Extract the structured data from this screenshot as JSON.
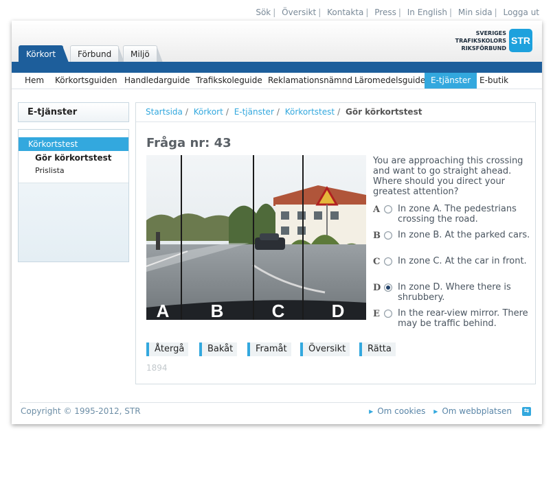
{
  "toplinks": [
    {
      "label": "Sök"
    },
    {
      "label": "Översikt"
    },
    {
      "label": "Kontakta"
    },
    {
      "label": "Press"
    },
    {
      "label": "In English"
    },
    {
      "label": "Min sida"
    },
    {
      "label": "Logga ut"
    }
  ],
  "separator": "|",
  "tabs": [
    {
      "label": "Körkort",
      "active": true
    },
    {
      "label": "Förbund",
      "active": false
    },
    {
      "label": "Miljö",
      "active": false
    }
  ],
  "logo": {
    "line1": "SVERIGES",
    "line2": "TRAFIKSKOLORS",
    "line3": "RIKSFÖRBUND",
    "mark": "STR"
  },
  "menu": [
    {
      "label": "Hem"
    },
    {
      "label": "Körkortsguiden"
    },
    {
      "label": "Handledarguide"
    },
    {
      "label": "Trafikskoleguide"
    },
    {
      "label": "Reklamationsnämnd"
    },
    {
      "label": "Läromedelsguide"
    },
    {
      "label": "E-tjänster",
      "active": true
    },
    {
      "label": "E-butik"
    }
  ],
  "sidebar": {
    "title": "E-tjänster",
    "items": [
      {
        "label": "Körkortstest"
      },
      {
        "label": "Gör körkortstest"
      },
      {
        "label": "Prislista"
      }
    ]
  },
  "breadcrumb": {
    "items": [
      "Startsida",
      "Körkort",
      "E-tjänster",
      "Körkortstest"
    ],
    "current": "Gör körkortstest",
    "sep": "/"
  },
  "question": {
    "title": "Fråga nr: 43",
    "text": "You are approaching this crossing and want to go straight ahead. Where should you direct your greatest attention?",
    "image_zone_labels": [
      "A",
      "B",
      "C",
      "D"
    ],
    "options": [
      {
        "letter": "A",
        "text": "In zone A. The pedestrians crossing the road.",
        "selected": false
      },
      {
        "letter": "B",
        "text": "In zone B. At the parked cars.",
        "selected": false
      },
      {
        "letter": "C",
        "text": "In zone C. At the car in front.",
        "selected": false
      },
      {
        "letter": "D",
        "text": "In zone D. Where there is shrubbery.",
        "selected": true
      },
      {
        "letter": "E",
        "text": "In the rear-view mirror. There may be traffic behind.",
        "selected": false
      }
    ]
  },
  "buttons": {
    "back": "Återgå",
    "previous": "Bakåt",
    "next": "Framåt",
    "overview": "Översikt",
    "correct": "Rätta"
  },
  "counter": "1894",
  "footer": {
    "copyright": "Copyright © 1995-2012, STR",
    "cookies": "Om cookies",
    "about": "Om webbplatsen"
  },
  "colors": {
    "brand_blue": "#1d5e9b",
    "accent": "#33a8de"
  }
}
